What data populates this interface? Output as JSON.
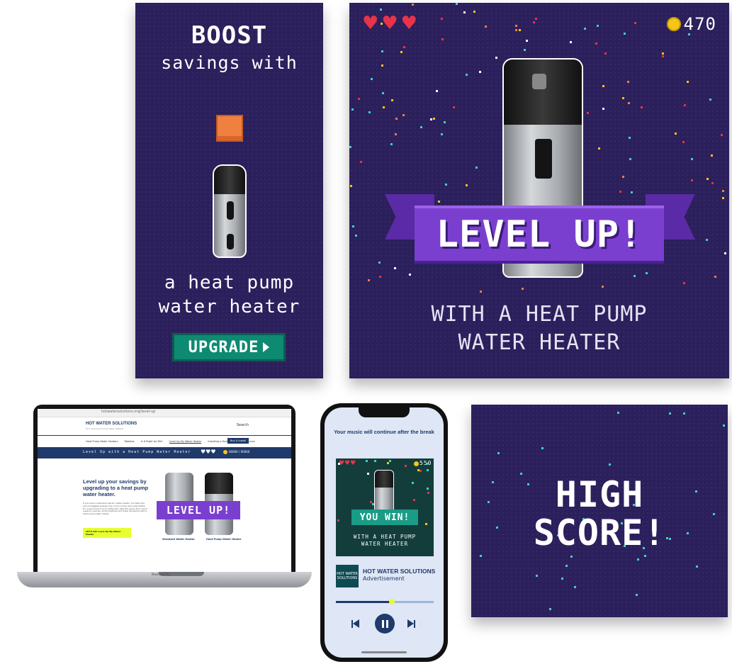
{
  "boost_ad": {
    "title": "BOOST",
    "subtitle": "savings with",
    "body_line1": "a heat pump",
    "body_line2": "water heater",
    "cta": "UPGRADE"
  },
  "level_up_ad": {
    "coins": "470",
    "banner": "LEVEL UP!",
    "tagline_line1": "WITH A HEAT PUMP",
    "tagline_line2": "WATER HEATER"
  },
  "high_score_ad": {
    "line1": "HIGH",
    "line2": "SCORE!"
  },
  "laptop": {
    "url": "hotwatersolutions.org/level-up",
    "logo": "HOT WATER SOLUTIONS",
    "logo_sub": "Your resource for hot water heaters",
    "search": "Search",
    "nav": [
      "Heat Pump Water Heaters",
      "Rebates",
      "Is It Right for Me?",
      "Level Up My Water Heater",
      "Installing a Heat Pump",
      "Resources"
    ],
    "nav_button": "Buy & Install",
    "banner_text": "Level Up with a Heat Pump Water Heater",
    "banner_score": "00000 / 00000",
    "headline": "Level up your savings by upgrading to a heat pump water heater.",
    "body": "If you have a standard electric water heater, it's likely the second-biggest energy hog in your home (and responsible for a big chunk of your utility bill). Play the game and unlock superior savings, smart features and lower emissions with a heat pump water heater.",
    "cta": "LET'S GO! Level Up My Water Heater",
    "overlay_banner": "LEVEL UP!",
    "caption_left": "Standard Water Heater",
    "caption_right": "Heat Pump Water Heater",
    "brand": "MacBook Pro"
  },
  "phone": {
    "notice": "Your music will continue after the break",
    "coins": "550",
    "ad_banner": "YOU WIN!",
    "ad_tagline_line1": "WITH A HEAT PUMP",
    "ad_tagline_line2": "WATER HEATER",
    "logo_line1": "HOT WATER",
    "logo_line2": "SOLUTIONS",
    "sponsor": "HOT WATER SOLUTIONS",
    "sponsor_sub": "Advertisement",
    "progress": 0.57
  },
  "colors": {
    "panel_bg": "#2b1f5c",
    "banner_purple": "#7b3fd0",
    "teal_button": "#0e8a72",
    "coin_yellow": "#f5c518",
    "heart_red": "#e8334a",
    "laptop_nav_blue": "#1f3a6b",
    "lime_cta": "#e7ff2e",
    "phone_green_ad": "#123d3b"
  }
}
